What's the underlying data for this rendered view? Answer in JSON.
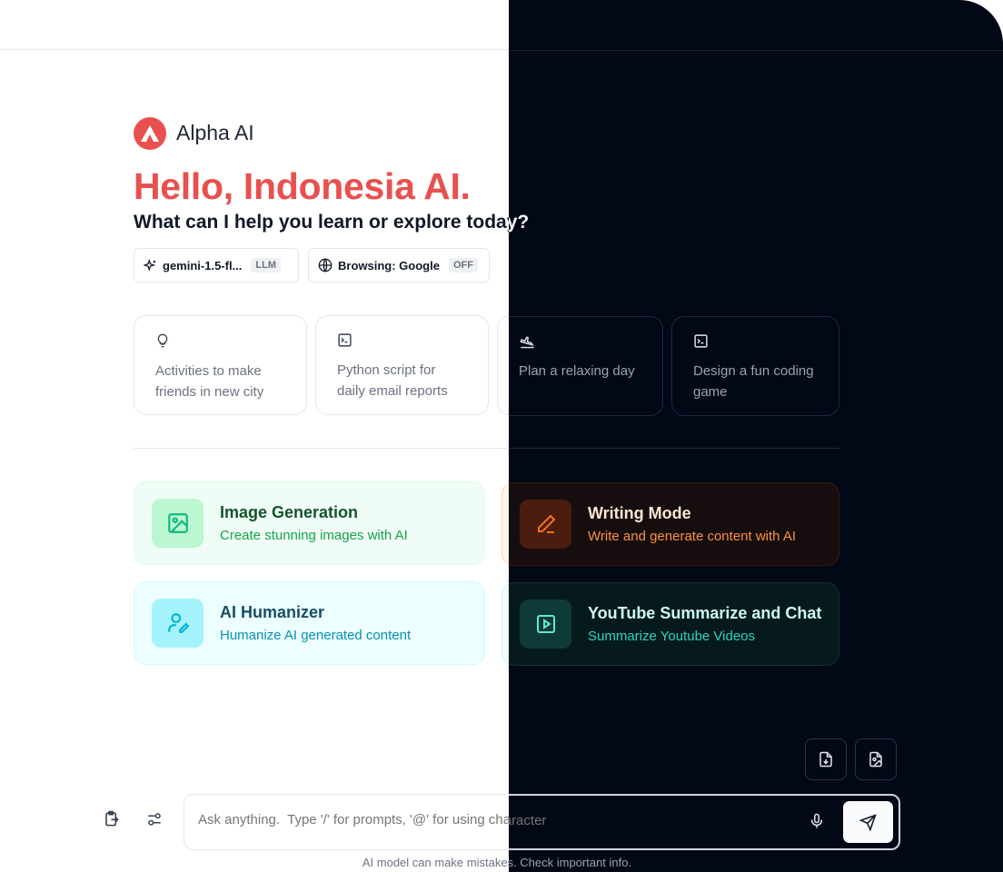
{
  "brand": {
    "name": "Alpha AI",
    "accent": "#e8504f"
  },
  "greeting": {
    "title": "Hello, Indonesia AI.",
    "subtitle": "What can I help you learn or explore today?"
  },
  "model_pill": {
    "label": "gemini-1.5-fl...",
    "badge": "LLM",
    "icon": "sparkles-icon"
  },
  "browsing_pill": {
    "label": "Browsing: Google",
    "badge": "OFF",
    "icon": "globe-icon"
  },
  "prompt_cards": [
    {
      "icon": "lightbulb-icon",
      "text": "Activities to make friends in new city"
    },
    {
      "icon": "terminal-icon",
      "text": "Python script for daily email reports"
    },
    {
      "icon": "plane-landing-icon",
      "text": "Plan a relaxing day"
    },
    {
      "icon": "terminal-icon",
      "text": "Design a fun coding game"
    }
  ],
  "features": [
    {
      "icon": "image-icon",
      "title": "Image Generation",
      "subtitle": "Create stunning images with AI",
      "color": "#10b981"
    },
    {
      "icon": "pencil-icon",
      "title": "Writing Mode",
      "subtitle": "Write and generate content with AI",
      "color": "#f97316"
    },
    {
      "icon": "user-pen-icon",
      "title": "AI Humanizer",
      "subtitle": "Humanize AI generated content",
      "color": "#06b6d4"
    },
    {
      "icon": "video-icon",
      "title": "YouTube Summarize and Chat",
      "subtitle": "Summarize Youtube Videos",
      "color": "#2dd4bf"
    }
  ],
  "tools": [
    {
      "icon": "file-upload-icon"
    },
    {
      "icon": "file-image-icon"
    }
  ],
  "input": {
    "placeholder": "Ask anything.  Type '/' for prompts, '@' for using character"
  },
  "disclaimer": "AI model can make mistakes. Check important info."
}
